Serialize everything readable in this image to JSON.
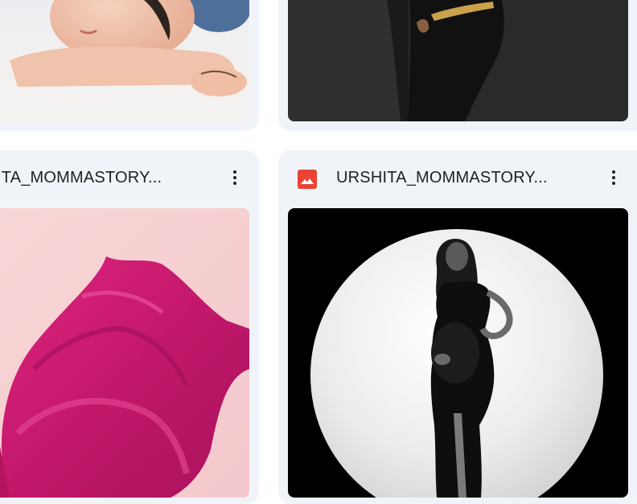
{
  "cards": [
    {
      "id": "top-left",
      "title": "",
      "thumb_alt": "Baby lying on white blanket"
    },
    {
      "id": "top-right",
      "title": "",
      "thumb_alt": "Maternity portrait in black dress with gold belt"
    },
    {
      "id": "bottom-left",
      "title": "ITA_MOMMASTORY...",
      "icon": "more-vert-icon",
      "thumb_alt": "Flowing magenta fabric on pink background"
    },
    {
      "id": "bottom-right",
      "title": "URSHITA_MOMMASTORY...",
      "file_type_icon": "image-file-icon",
      "icon": "more-vert-icon",
      "thumb_alt": "Black and white maternity portrait in circular frame"
    }
  ],
  "colors": {
    "card_bg": "#f0f4f9",
    "image_icon_red": "#ea4335",
    "text": "#1f1f1f",
    "magenta": "#c2186b"
  }
}
